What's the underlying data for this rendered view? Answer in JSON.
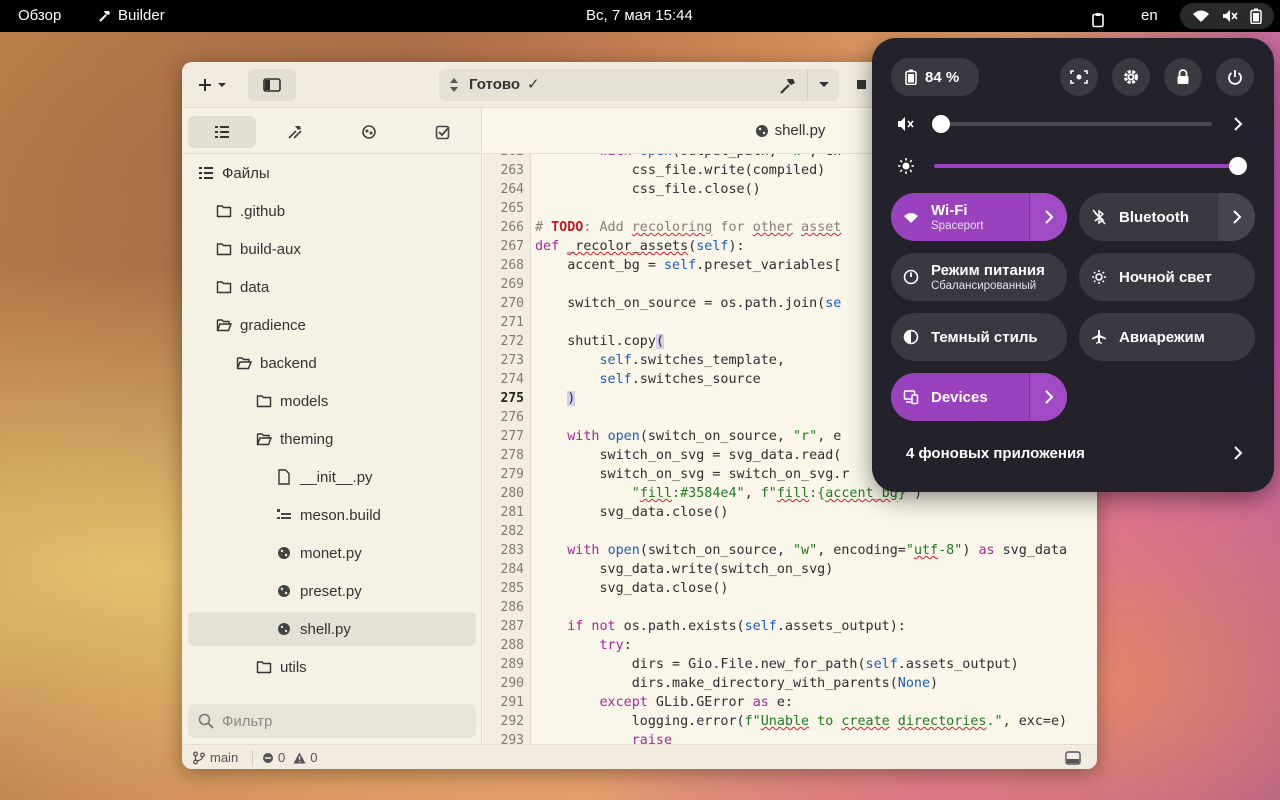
{
  "topbar": {
    "overview": "Обзор",
    "app_name": "Builder",
    "clock": "Вс, 7 мая  15:44",
    "lang": "en"
  },
  "header": {
    "status": "Готово",
    "status_check": "✓"
  },
  "sidebar": {
    "root_label": "Файлы",
    "items": [
      {
        "label": ".github"
      },
      {
        "label": "build-aux"
      },
      {
        "label": "data"
      },
      {
        "label": "gradience"
      },
      {
        "label": "backend"
      },
      {
        "label": "models"
      },
      {
        "label": "theming"
      },
      {
        "label": "__init__.py"
      },
      {
        "label": "meson.build"
      },
      {
        "label": "monet.py"
      },
      {
        "label": "preset.py"
      },
      {
        "label": "shell.py"
      },
      {
        "label": "utils"
      }
    ],
    "filter_placeholder": "Фильтр"
  },
  "editor": {
    "tab_title": "shell.py",
    "current_line": "275"
  },
  "statusbar": {
    "branch": "main",
    "errors": "0",
    "warnings": "0"
  },
  "quick_settings": {
    "battery": "84 %",
    "volume_level": 0.0,
    "brightness_level": 1.0,
    "toggles": {
      "wifi_title": "Wi-Fi",
      "wifi_sub": "Spaceport",
      "bluetooth_title": "Bluetooth",
      "power_title": "Режим питания",
      "power_sub": "Сбалансированный",
      "night_title": "Ночной свет",
      "dark_title": "Темный стиль",
      "airplane_title": "Авиарежим",
      "devices_title": "Devices"
    },
    "background_apps": "4 фоновых приложения"
  },
  "colors": {
    "accent": "#9a42bd",
    "topbar": "#000000",
    "panel": "#23222b"
  }
}
